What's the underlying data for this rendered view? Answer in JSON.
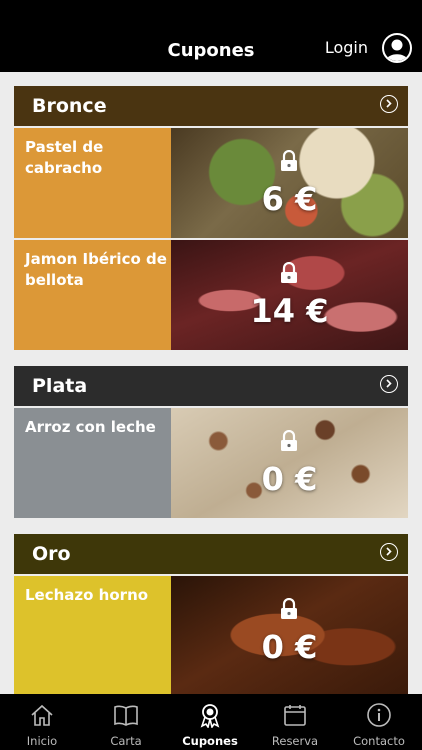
{
  "header": {
    "title": "Cupones",
    "login_label": "Login"
  },
  "sections": [
    {
      "name": "Bronce",
      "color": "#4a3411",
      "coupons": [
        {
          "label": "Pastel de cabracho",
          "price": "6 €",
          "color": "#dc9837"
        },
        {
          "label": "Jamon Ibérico de bellota",
          "price": "14 €",
          "color": "#dc9837"
        }
      ]
    },
    {
      "name": "Plata",
      "color": "#2c2c2c",
      "coupons": [
        {
          "label": "Arroz con leche",
          "price": "0 €",
          "color": "#8a8f93"
        }
      ]
    },
    {
      "name": "Oro",
      "color": "#3e3709",
      "coupons": [
        {
          "label": "Lechazo horno",
          "price": "0 €",
          "color": "#ddc22b"
        }
      ]
    }
  ],
  "tabs": [
    {
      "label": "Inicio",
      "icon": "home-icon",
      "active": false
    },
    {
      "label": "Carta",
      "icon": "book-icon",
      "active": false
    },
    {
      "label": "Cupones",
      "icon": "award-icon",
      "active": true
    },
    {
      "label": "Reserva",
      "icon": "calendar-icon",
      "active": false
    },
    {
      "label": "Contacto",
      "icon": "info-icon",
      "active": false
    }
  ]
}
